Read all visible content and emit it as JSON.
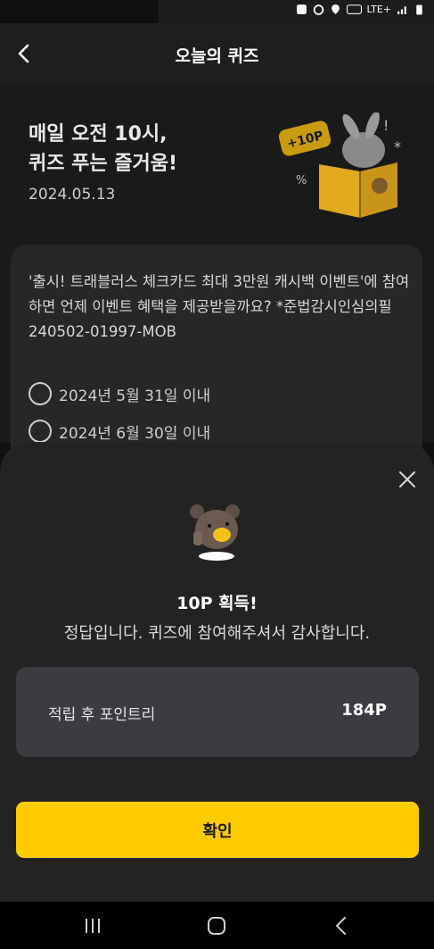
{
  "status_bar": {
    "network": "LTE+"
  },
  "app_bar": {
    "title": "오늘의 퀴즈"
  },
  "hero": {
    "title": "매일 오전 10시,\n퀴즈 푸는 즐거움!",
    "date": "2024.05.13",
    "badge": "+10P"
  },
  "quiz": {
    "question": "'출시! 트래블러스 체크카드 최대 3만원 캐시백 이벤트'에 참여하면 언제 이벤트 혜택을 제공받을까요? *준법감시인심의필 240502-01997-MOB",
    "options": [
      "2024년 5월 31일 이내",
      "2024년 6월 30일 이내"
    ]
  },
  "sheet": {
    "title": "10P 획득!",
    "subtitle": "정답입니다. 퀴즈에 참여해주셔서 감사합니다.",
    "points_label": "적립 후 포인트리",
    "points_value": "184P",
    "confirm_label": "확인"
  },
  "colors": {
    "accent": "#fecb00",
    "sheet_bg": "#232323",
    "card_bg": "#272727"
  },
  "icons": [
    "back-arrow-icon",
    "close-icon",
    "recents-icon",
    "home-icon",
    "back-icon"
  ]
}
